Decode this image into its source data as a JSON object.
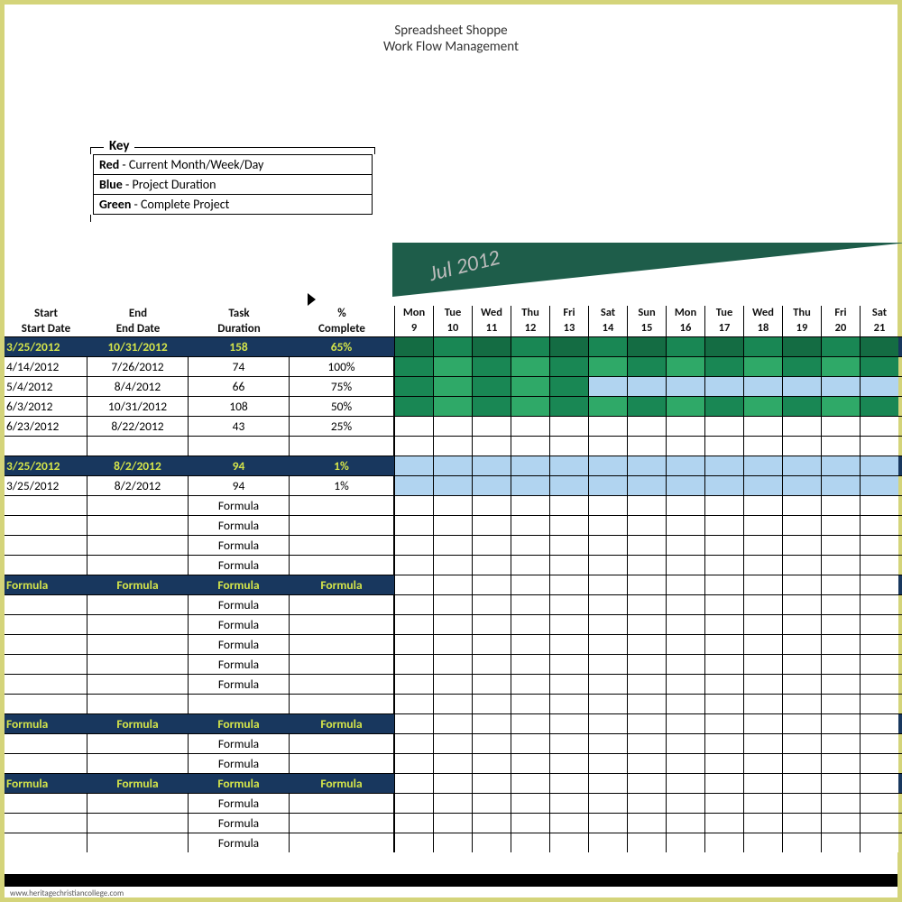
{
  "header": {
    "line1": "Spreadsheet Shoppe",
    "line2": "Work Flow Management"
  },
  "key": {
    "label": "Key",
    "rows": [
      {
        "color": "Red",
        "text": "Current Month/Week/Day"
      },
      {
        "color": "Blue",
        "text": "Project Duration"
      },
      {
        "color": "Green",
        "text": "Complete Project"
      }
    ]
  },
  "monthLabel": "Jul 2012",
  "columns": {
    "start1": "Start",
    "start2": "Start Date",
    "end1": "End",
    "end2": "End Date",
    "dur1": "Task",
    "dur2": "Duration",
    "pct1": "%",
    "pct2": "Complete"
  },
  "days": [
    {
      "dow": "Mon",
      "num": "9"
    },
    {
      "dow": "Tue",
      "num": "10"
    },
    {
      "dow": "Wed",
      "num": "11"
    },
    {
      "dow": "Thu",
      "num": "12"
    },
    {
      "dow": "Fri",
      "num": "13"
    },
    {
      "dow": "Sat",
      "num": "14"
    },
    {
      "dow": "Sun",
      "num": "15"
    },
    {
      "dow": "Mon",
      "num": "16"
    },
    {
      "dow": "Tue",
      "num": "17"
    },
    {
      "dow": "Wed",
      "num": "18"
    },
    {
      "dow": "Thu",
      "num": "19"
    },
    {
      "dow": "Fri",
      "num": "20"
    },
    {
      "dow": "Sat",
      "num": "21"
    }
  ],
  "rows": [
    {
      "type": "summary",
      "start": "3/25/2012",
      "end": "10/31/2012",
      "dur": "158",
      "pct": "65%",
      "gantt": [
        "g-dgreen2",
        "g-dgreen",
        "g-dgreen2",
        "g-dgreen",
        "g-dgreen2",
        "g-dgreen",
        "g-dgreen2",
        "g-dgreen",
        "g-dgreen2",
        "g-dgreen",
        "g-dgreen2",
        "g-dgreen",
        "g-dgreen2"
      ]
    },
    {
      "type": "data",
      "start": "4/14/2012",
      "end": "7/26/2012",
      "dur": "74",
      "pct": "100%",
      "gantt": [
        "g-dgreen",
        "g-lgreen",
        "g-dgreen",
        "g-lgreen",
        "g-dgreen",
        "g-lgreen",
        "g-dgreen",
        "g-lgreen",
        "g-dgreen",
        "g-lgreen",
        "g-dgreen",
        "g-lgreen",
        "g-dgreen"
      ]
    },
    {
      "type": "data",
      "start": "5/4/2012",
      "end": "8/4/2012",
      "dur": "66",
      "pct": "75%",
      "gantt": [
        "g-dgreen",
        "g-lgreen",
        "g-dgreen",
        "g-lgreen",
        "g-dgreen",
        "g-lblue",
        "g-lblue",
        "g-lblue",
        "g-lblue",
        "g-lblue",
        "g-lblue",
        "g-lblue",
        "g-lblue"
      ]
    },
    {
      "type": "data",
      "start": "6/3/2012",
      "end": "10/31/2012",
      "dur": "108",
      "pct": "50%",
      "gantt": [
        "g-dgreen",
        "g-lgreen",
        "g-dgreen",
        "g-lgreen",
        "g-dgreen",
        "g-lgreen",
        "g-dgreen",
        "g-lgreen",
        "g-dgreen",
        "g-lgreen",
        "g-dgreen",
        "g-lgreen",
        "g-dgreen"
      ]
    },
    {
      "type": "data",
      "start": "6/23/2012",
      "end": "8/22/2012",
      "dur": "43",
      "pct": "25%",
      "gantt": [
        "g-white",
        "g-white",
        "g-white",
        "g-white",
        "g-white",
        "g-white",
        "g-white",
        "g-white",
        "g-white",
        "g-white",
        "g-white",
        "g-white",
        "g-white"
      ]
    },
    {
      "type": "blank"
    },
    {
      "type": "summary",
      "start": "3/25/2012",
      "end": "8/2/2012",
      "dur": "94",
      "pct": "1%",
      "gantt": [
        "g-lblue",
        "g-lblue",
        "g-lblue",
        "g-lblue",
        "g-lblue",
        "g-lblue",
        "g-lblue",
        "g-lblue",
        "g-lblue",
        "g-lblue",
        "g-lblue",
        "g-lblue",
        "g-lblue"
      ]
    },
    {
      "type": "data",
      "start": "3/25/2012",
      "end": "8/2/2012",
      "dur": "94",
      "pct": "1%",
      "gantt": [
        "g-lblue",
        "g-lblue",
        "g-lblue",
        "g-lblue",
        "g-lblue",
        "g-lblue",
        "g-lblue",
        "g-lblue",
        "g-lblue",
        "g-lblue",
        "g-lblue",
        "g-lblue",
        "g-lblue"
      ]
    },
    {
      "type": "data",
      "start": "",
      "end": "",
      "dur": "Formula",
      "pct": "",
      "gantt": []
    },
    {
      "type": "data",
      "start": "",
      "end": "",
      "dur": "Formula",
      "pct": "",
      "gantt": []
    },
    {
      "type": "data",
      "start": "",
      "end": "",
      "dur": "Formula",
      "pct": "",
      "gantt": []
    },
    {
      "type": "data",
      "start": "",
      "end": "",
      "dur": "Formula",
      "pct": "",
      "gantt": []
    },
    {
      "type": "summary",
      "start": "Formula",
      "end": "Formula",
      "dur": "Formula",
      "pct": "Formula",
      "gantt": []
    },
    {
      "type": "data",
      "start": "",
      "end": "",
      "dur": "Formula",
      "pct": "",
      "gantt": []
    },
    {
      "type": "data",
      "start": "",
      "end": "",
      "dur": "Formula",
      "pct": "",
      "gantt": []
    },
    {
      "type": "data",
      "start": "",
      "end": "",
      "dur": "Formula",
      "pct": "",
      "gantt": []
    },
    {
      "type": "data",
      "start": "",
      "end": "",
      "dur": "Formula",
      "pct": "",
      "gantt": []
    },
    {
      "type": "data",
      "start": "",
      "end": "",
      "dur": "Formula",
      "pct": "",
      "gantt": []
    },
    {
      "type": "blank"
    },
    {
      "type": "summary",
      "start": "Formula",
      "end": "Formula",
      "dur": "Formula",
      "pct": "Formula",
      "gantt": []
    },
    {
      "type": "data",
      "start": "",
      "end": "",
      "dur": "Formula",
      "pct": "",
      "gantt": []
    },
    {
      "type": "data",
      "start": "",
      "end": "",
      "dur": "Formula",
      "pct": "",
      "gantt": []
    },
    {
      "type": "summary",
      "start": "Formula",
      "end": "Formula",
      "dur": "Formula",
      "pct": "Formula",
      "gantt": []
    },
    {
      "type": "data",
      "start": "",
      "end": "",
      "dur": "Formula",
      "pct": "",
      "gantt": []
    },
    {
      "type": "data",
      "start": "",
      "end": "",
      "dur": "Formula",
      "pct": "",
      "gantt": []
    },
    {
      "type": "data",
      "start": "",
      "end": "",
      "dur": "Formula",
      "pct": "",
      "gantt": []
    }
  ],
  "watermark": "www.heritagechristiancollege.com"
}
